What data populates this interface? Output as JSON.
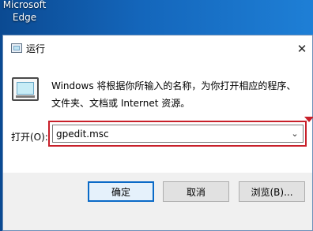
{
  "desktop": {
    "shortcut_label_line1": "Microsoft",
    "shortcut_label_line2": "Edge"
  },
  "dialog": {
    "title": "运行",
    "description_line1": "Windows 将根据你所输入的名称，为你打开相应的程序、",
    "description_line2": "文件夹、文档或 Internet 资源。",
    "open_label": "打开(O):",
    "input_value": "gpedit.msc",
    "close_icon": "close-icon",
    "dropdown_icon": "chevron-down-icon"
  },
  "buttons": {
    "ok": "确定",
    "cancel": "取消",
    "browse": "浏览(B)..."
  },
  "colors": {
    "highlight": "#c8202a",
    "accent": "#0a6ac7"
  }
}
